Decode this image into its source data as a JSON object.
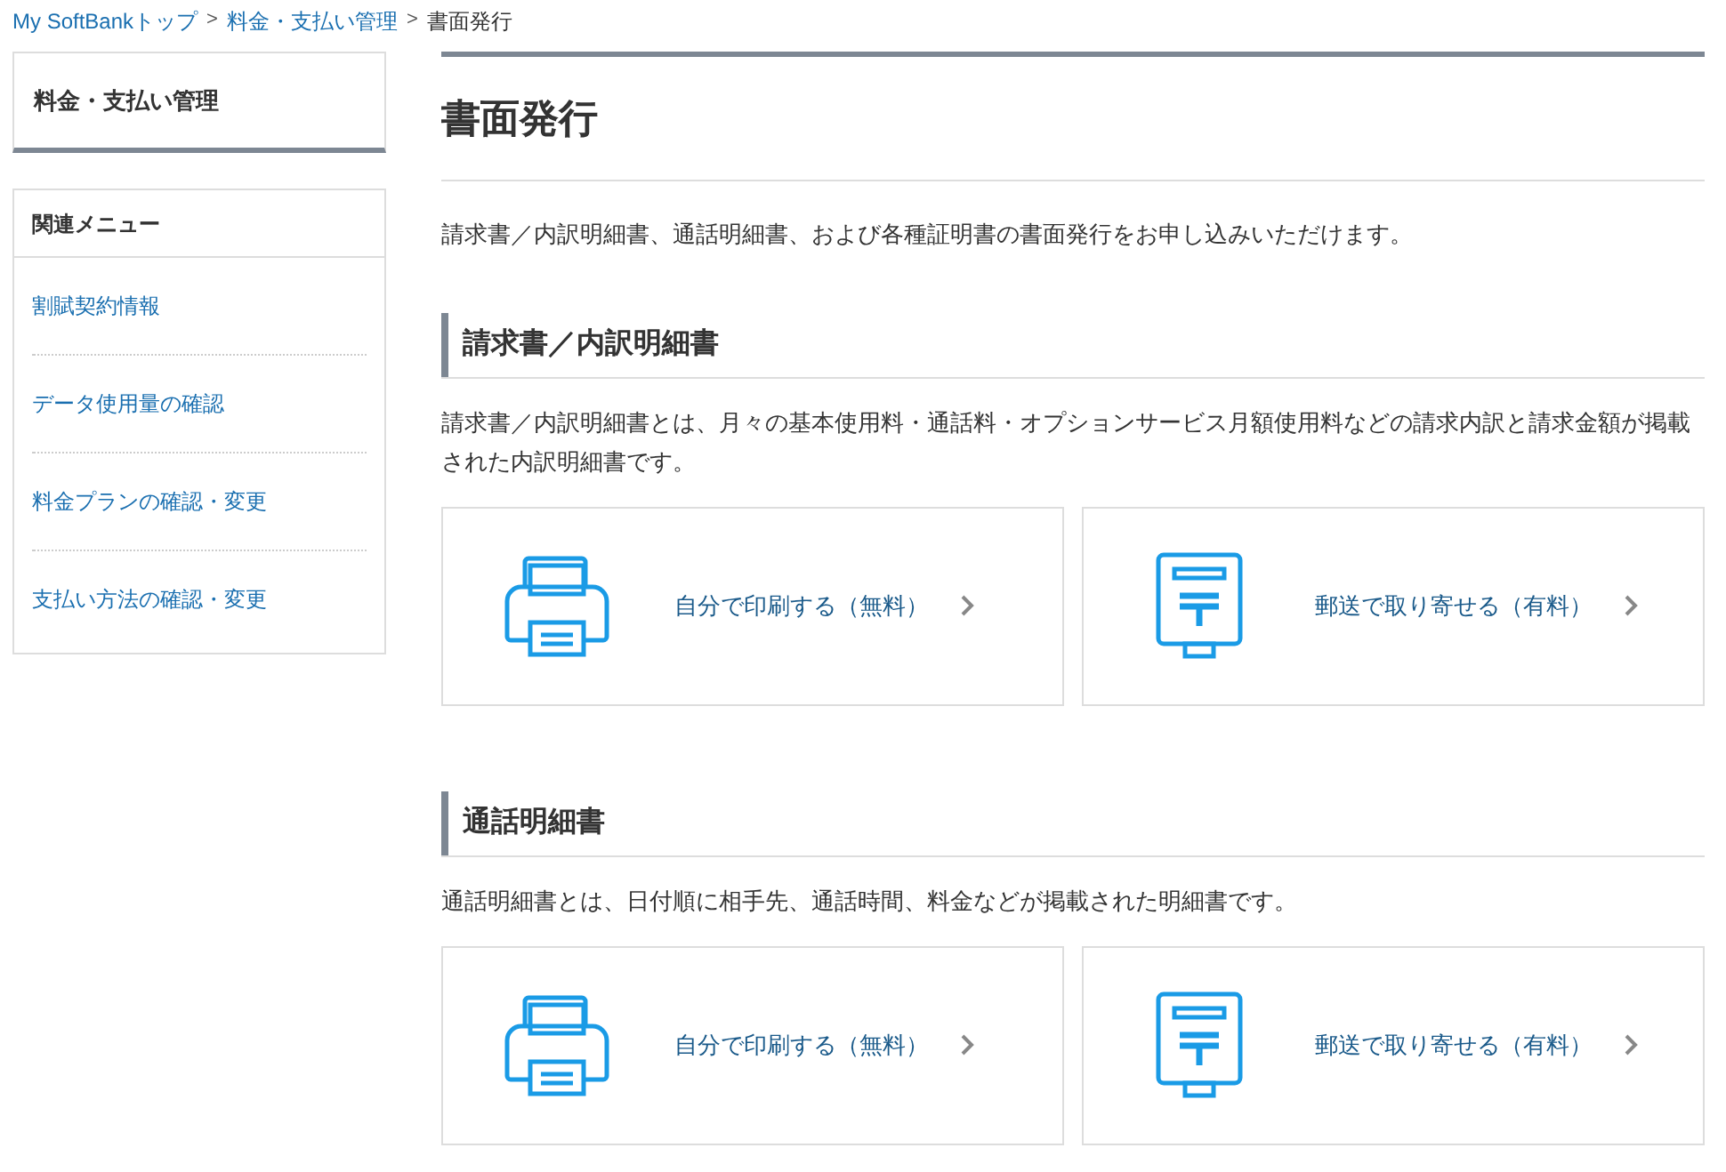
{
  "breadcrumb": [
    {
      "label": "My SoftBankトップ",
      "link": true
    },
    {
      "label": "料金・支払い管理",
      "link": true
    },
    {
      "label": "書面発行",
      "link": false
    }
  ],
  "breadcrumb_separator": ">",
  "sidebar": {
    "title": "料金・支払い管理",
    "menu_title": "関連メニュー",
    "items": [
      {
        "label": "割賦契約情報"
      },
      {
        "label": "データ使用量の確認"
      },
      {
        "label": "料金プランの確認・変更"
      },
      {
        "label": "支払い方法の確認・変更"
      }
    ]
  },
  "page": {
    "title": "書面発行",
    "intro": "請求書／内訳明細書、通話明細書、および各種証明書の書面発行をお申し込みいただけます。",
    "sections": [
      {
        "heading": "請求書／内訳明細書",
        "description": "請求書／内訳明細書とは、月々の基本使用料・通話料・オプションサービス月額使用料などの請求内訳と請求金額が掲載された内訳明細書です。",
        "options": [
          {
            "kind": "print",
            "label": "自分で印刷する（無料）"
          },
          {
            "kind": "mail",
            "label": "郵送で取り寄せる（有料）"
          }
        ]
      },
      {
        "heading": "通話明細書",
        "description": "通話明細書とは、日付順に相手先、通話時間、料金などが掲載された明細書です。",
        "options": [
          {
            "kind": "print",
            "label": "自分で印刷する（無料）"
          },
          {
            "kind": "mail",
            "label": "郵送で取り寄せる（有料）"
          }
        ]
      }
    ]
  }
}
